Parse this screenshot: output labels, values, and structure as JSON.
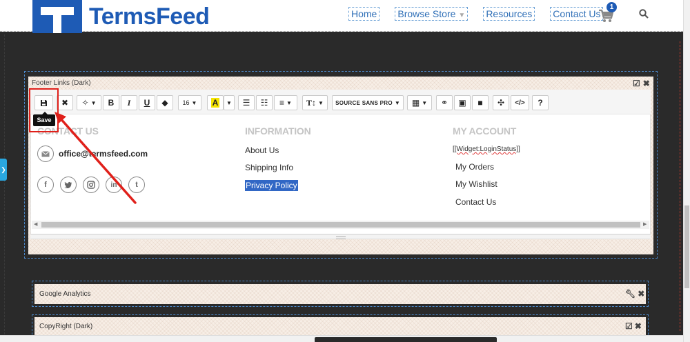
{
  "header": {
    "logo_text": "TermsFeed",
    "nav": [
      {
        "label": "Home"
      },
      {
        "label": "Browse Store"
      },
      {
        "label": "Resources"
      },
      {
        "label": "Contact Us"
      }
    ],
    "cart_count": "1"
  },
  "footer_widget": {
    "title": "Footer Links (Dark)",
    "toolbar": {
      "font_size": "16",
      "font_name": "SOURCE SANS PRO",
      "save_tooltip": "Save"
    },
    "columns": {
      "contact": {
        "heading": "CONTACT US",
        "email": "office@termsfeed.com"
      },
      "information": {
        "heading": "INFORMATION",
        "links": [
          "About Us",
          "Shipping Info",
          "Privacy Policy"
        ]
      },
      "account": {
        "heading": "MY ACCOUNT",
        "widget_token": "[[Widget:LoginStatus]]",
        "links": [
          "My Orders",
          "My Wishlist",
          "Contact Us"
        ]
      }
    }
  },
  "widgets": [
    {
      "title": "Google Analytics"
    },
    {
      "title": "CopyRight (Dark)"
    }
  ],
  "colors": {
    "brand": "#1e5bb5",
    "highlight": "#e0201a",
    "selection": "#3167c5",
    "page_bg": "#2a2a2a"
  }
}
